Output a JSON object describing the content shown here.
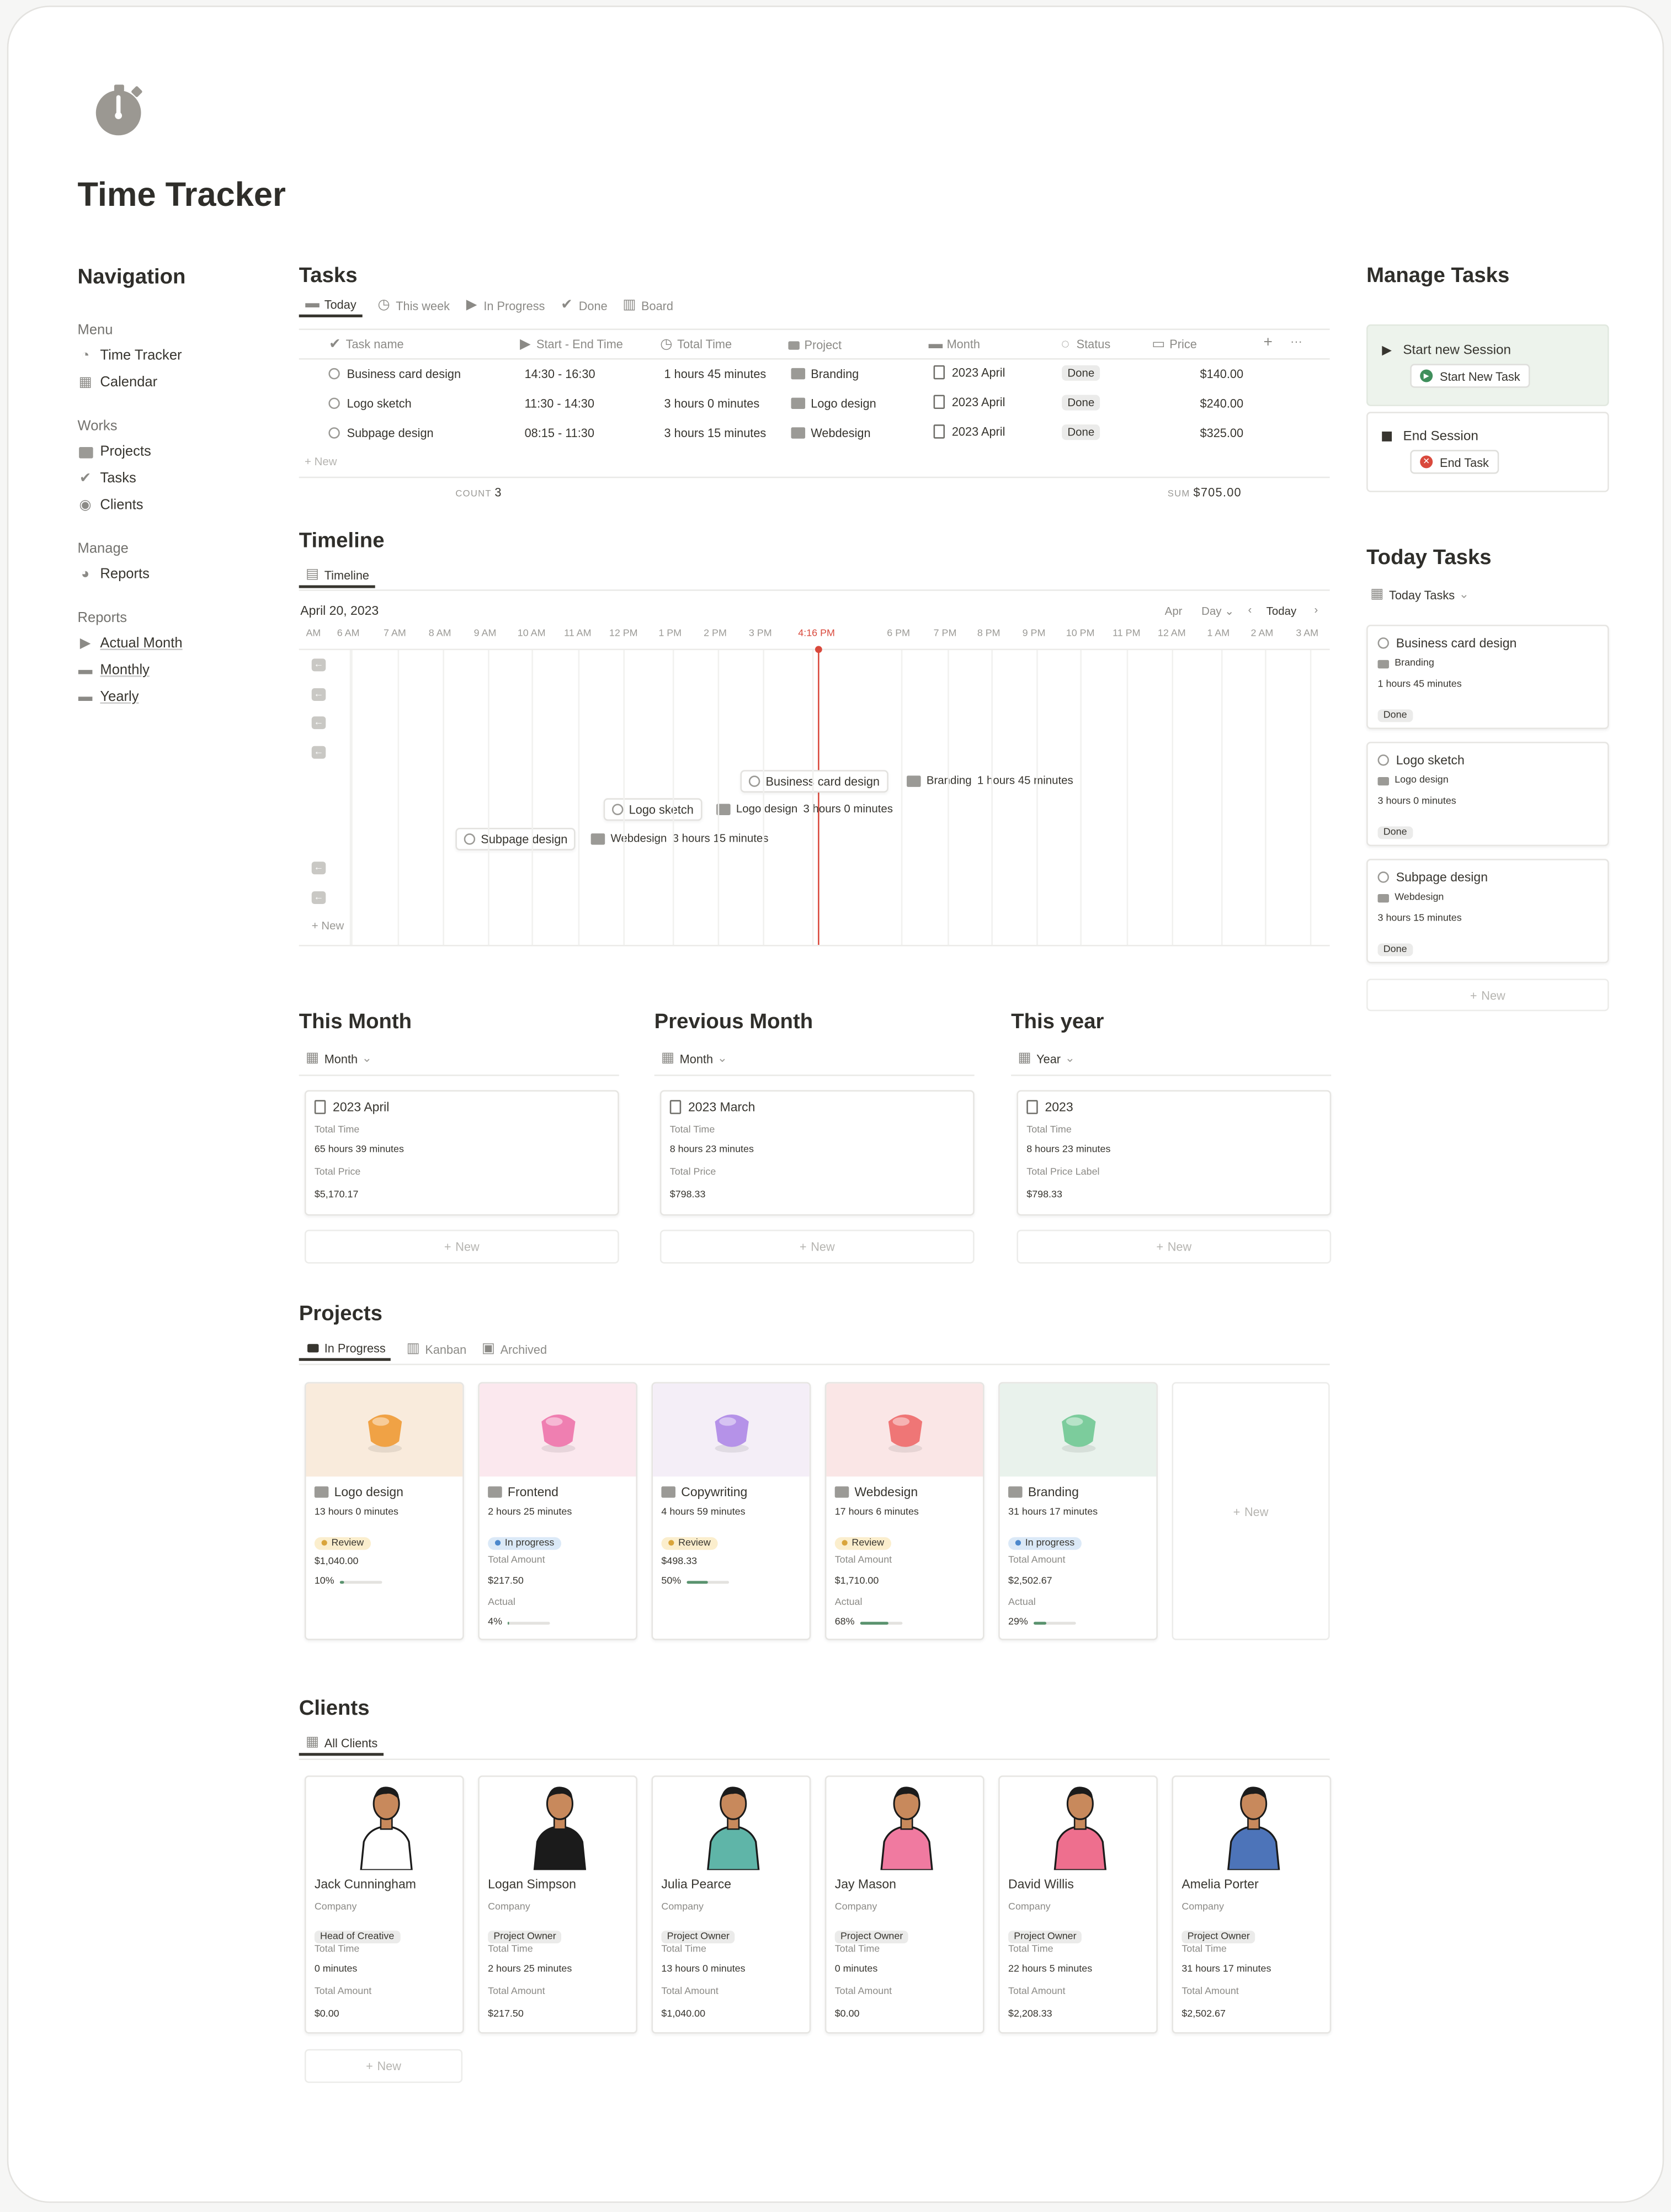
{
  "page": {
    "title": "Time Tracker"
  },
  "icons": {
    "page": "stopwatch-icon"
  },
  "nav": {
    "title": "Navigation",
    "menu": {
      "label": "Menu",
      "items": [
        "Time Tracker",
        "Calendar"
      ]
    },
    "works": {
      "label": "Works",
      "items": [
        "Projects",
        "Tasks",
        "Clients"
      ]
    },
    "manage": {
      "label": "Manage",
      "items": [
        "Reports"
      ]
    },
    "reports": {
      "label": "Reports",
      "items": [
        "Actual Month",
        "Monthly",
        "Yearly"
      ]
    }
  },
  "tasks": {
    "title": "Tasks",
    "tabs": [
      "Today",
      "This week",
      "In Progress",
      "Done",
      "Board"
    ],
    "columns": [
      "Task name",
      "Start - End Time",
      "Total Time",
      "Project",
      "Month",
      "Status",
      "Price"
    ],
    "rows": [
      {
        "name": "Business card design",
        "time": "14:30  -  16:30",
        "total": "1 hours 45 minutes",
        "project": "Branding",
        "month": "2023 April",
        "status": "Done",
        "price": "$140.00"
      },
      {
        "name": "Logo sketch",
        "time": "11:30  -  14:30",
        "total": "3 hours 0 minutes",
        "project": "Logo design",
        "month": "2023 April",
        "status": "Done",
        "price": "$240.00"
      },
      {
        "name": "Subpage design",
        "time": "08:15  -  11:30",
        "total": "3 hours 15 minutes",
        "project": "Webdesign",
        "month": "2023 April",
        "status": "Done",
        "price": "$325.00"
      }
    ],
    "new": "New",
    "count_label": "COUNT",
    "count": "3",
    "sum_label": "SUM",
    "sum": "$705.00"
  },
  "timeline": {
    "title": "Timeline",
    "tab": "Timeline",
    "date": "April 20, 2023",
    "ctrl_month": "Apr",
    "ctrl_scale": "Day",
    "ctrl_today": "Today",
    "ticks": [
      "AM",
      "6 AM",
      "7 AM",
      "8 AM",
      "9 AM",
      "10 AM",
      "11 AM",
      "12 PM",
      "1 PM",
      "2 PM",
      "3 PM",
      "4:16 PM",
      "6 PM",
      "7 PM",
      "8 PM",
      "9 PM",
      "10 PM",
      "11 PM",
      "12 AM",
      "1 AM",
      "2 AM",
      "3 AM"
    ],
    "bars": [
      {
        "name": "Business card design",
        "project": "Branding",
        "total": "1 hours 45 minutes"
      },
      {
        "name": "Logo sketch",
        "project": "Logo design",
        "total": "3 hours 0 minutes"
      },
      {
        "name": "Subpage design",
        "project": "Webdesign",
        "total": "3 hours 15 minutes"
      }
    ],
    "new": "New"
  },
  "manage_tasks": {
    "title": "Manage Tasks",
    "start_label": "Start new Session",
    "start_btn": "Start New Task",
    "end_label": "End Session",
    "end_btn": "End Task"
  },
  "today_tasks": {
    "title": "Today Tasks",
    "view": "Today Tasks",
    "cards": [
      {
        "name": "Business card design",
        "project": "Branding",
        "total": "1 hours 45 minutes",
        "status": "Done"
      },
      {
        "name": "Logo sketch",
        "project": "Logo design",
        "total": "3 hours 0 minutes",
        "status": "Done"
      },
      {
        "name": "Subpage design",
        "project": "Webdesign",
        "total": "3 hours 15 minutes",
        "status": "Done"
      }
    ],
    "new": "New"
  },
  "this_month": {
    "title": "This Month",
    "view": "Month",
    "card": {
      "name": "2023 April",
      "l1": "Total Time",
      "v1": "65 hours 39 minutes",
      "l2": "Total Price",
      "v2": "$5,170.17"
    },
    "new": "New"
  },
  "prev_month": {
    "title": "Previous Month",
    "view": "Month",
    "card": {
      "name": "2023 March",
      "l1": "Total Time",
      "v1": "8 hours 23 minutes",
      "l2": "Total Price",
      "v2": "$798.33"
    },
    "new": "New"
  },
  "this_year": {
    "title": "This year",
    "view": "Year",
    "card": {
      "name": "2023",
      "l1": "Total Time",
      "v1": "8 hours 23 minutes",
      "l2": "Total Price Label",
      "v2": "$798.33"
    },
    "new": "New"
  },
  "projects": {
    "title": "Projects",
    "tabs": [
      "In Progress",
      "Kanban",
      "Archived"
    ],
    "cards": [
      {
        "name": "Logo design",
        "time": "13 hours 0 minutes",
        "status": "Review",
        "amount_label": "",
        "amount": "$1,040.00",
        "actual_label": "",
        "pct": "10%",
        "frac": 0.1,
        "bg": "#f9ebdc",
        "obj": "#f0a245"
      },
      {
        "name": "Frontend",
        "time": "2 hours 25 minutes",
        "status": "In progress",
        "amount_label": "Total Amount",
        "amount": "$217.50",
        "actual_label": "Actual",
        "pct": "4%",
        "frac": 0.04,
        "bg": "#fbe8ee",
        "obj": "#ef7fb1"
      },
      {
        "name": "Copywriting",
        "time": "4 hours 59 minutes",
        "status": "Review",
        "amount_label": "",
        "amount": "$498.33",
        "actual_label": "",
        "pct": "50%",
        "frac": 0.5,
        "bg": "#f4eef7",
        "obj": "#b592e8"
      },
      {
        "name": "Webdesign",
        "time": "17 hours 6 minutes",
        "status": "Review",
        "amount_label": "Total Amount",
        "amount": "$1,710.00",
        "actual_label": "Actual",
        "pct": "68%",
        "frac": 0.68,
        "bg": "#fae6e6",
        "obj": "#ef7676"
      },
      {
        "name": "Branding",
        "time": "31 hours 17 minutes",
        "status": "In progress",
        "amount_label": "Total Amount",
        "amount": "$2,502.67",
        "actual_label": "Actual",
        "pct": "29%",
        "frac": 0.29,
        "bg": "#e9f2ec",
        "obj": "#7ccc9c"
      }
    ],
    "new": "New"
  },
  "clients": {
    "title": "Clients",
    "tab": "All Clients",
    "cards": [
      {
        "name": "Jack Cunningham",
        "company_label": "Company",
        "role": "Head of Creative",
        "l1": "Total Time",
        "v1": "0 minutes",
        "l2": "Total Amount",
        "v2": "$0.00",
        "shirt": "#ffffff"
      },
      {
        "name": "Logan Simpson",
        "company_label": "Company",
        "role": "Project Owner",
        "l1": "Total Time",
        "v1": "2 hours 25 minutes",
        "l2": "Total Amount",
        "v2": "$217.50",
        "shirt": "#1b1b1b"
      },
      {
        "name": "Julia Pearce",
        "company_label": "Company",
        "role": "Project Owner",
        "l1": "Total Time",
        "v1": "13 hours 0 minutes",
        "l2": "Total Amount",
        "v2": "$1,040.00",
        "shirt": "#5fb5a8"
      },
      {
        "name": "Jay Mason",
        "company_label": "Company",
        "role": "Project Owner",
        "l1": "Total Time",
        "v1": "0 minutes",
        "l2": "Total Amount",
        "v2": "$0.00",
        "shirt": "#f07aa0"
      },
      {
        "name": "David Willis",
        "company_label": "Company",
        "role": "Project Owner",
        "l1": "Total Time",
        "v1": "22 hours 5 minutes",
        "l2": "Total Amount",
        "v2": "$2,208.33",
        "shirt": "#ee6f8e"
      },
      {
        "name": "Amelia Porter",
        "company_label": "Company",
        "role": "Project Owner",
        "l1": "Total Time",
        "v1": "31 hours 17 minutes",
        "l2": "Total Amount",
        "v2": "$2,502.67",
        "shirt": "#4d74b9"
      }
    ],
    "new": "New"
  },
  "colors": {
    "accent_now": "#d9493c",
    "review": "#fbeecd",
    "inprogress": "#dbe9f7",
    "progress": "#59926e",
    "session_bg": "#edf3ec"
  }
}
